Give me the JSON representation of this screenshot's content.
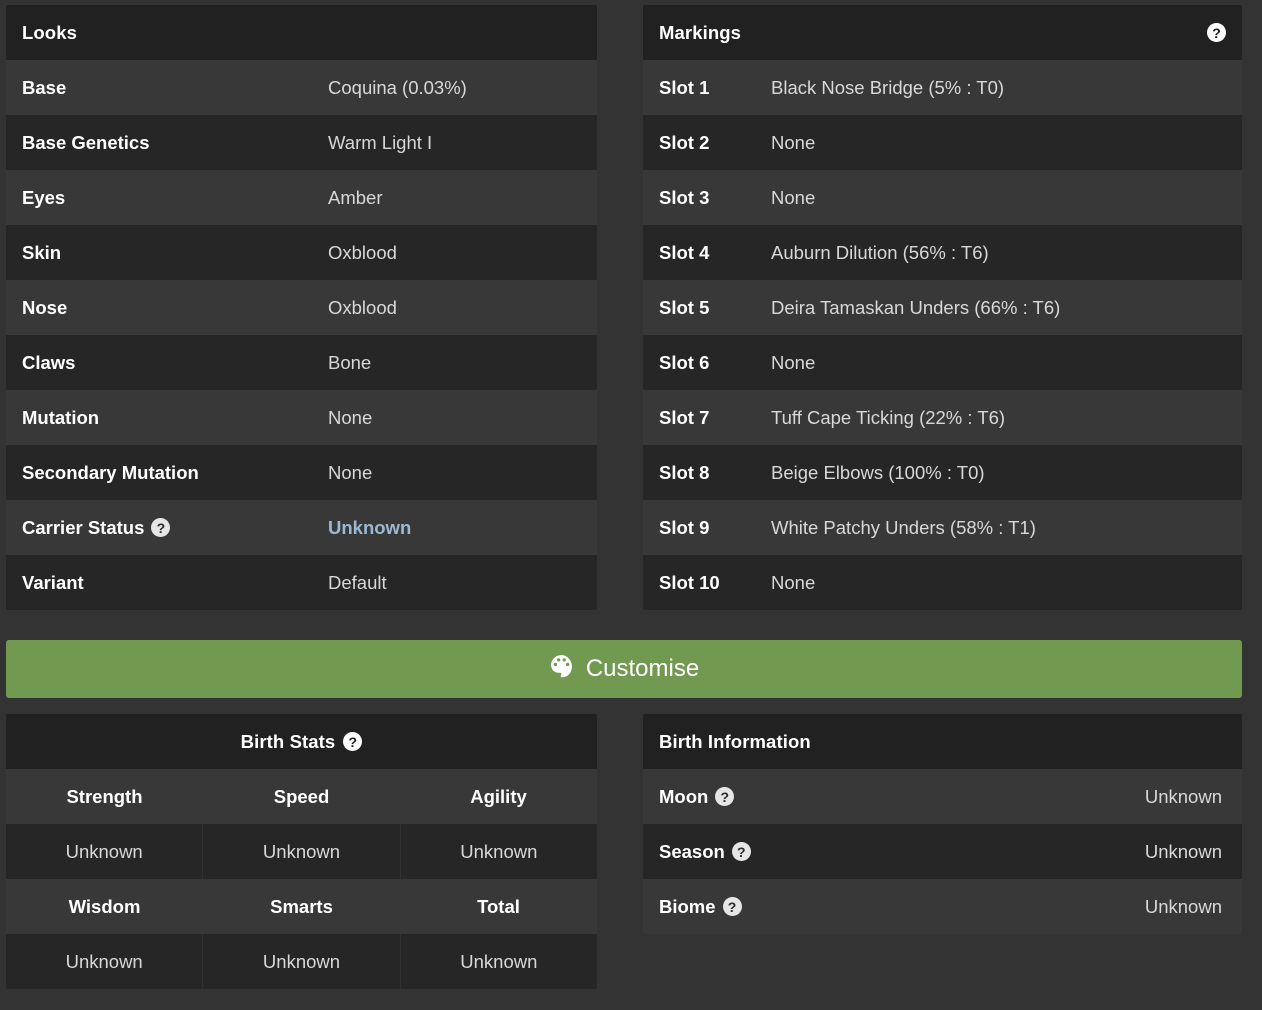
{
  "colors": {
    "page_background": "#333333",
    "panel_background": "#2b2b2b",
    "panel_header": "#212121",
    "row_odd": "#383838",
    "row_even": "#262626",
    "accent_green": "#729950",
    "link_blue": "#9cb9d4",
    "text_primary": "#ffffff",
    "text_value": "#d8d8d8"
  },
  "looks": {
    "title": "Looks",
    "rows": [
      {
        "key": "Base",
        "value": "Coquina (0.03%)",
        "help": false,
        "link": false
      },
      {
        "key": "Base Genetics",
        "value": "Warm Light I",
        "help": false,
        "link": false
      },
      {
        "key": "Eyes",
        "value": "Amber",
        "help": false,
        "link": false
      },
      {
        "key": "Skin",
        "value": "Oxblood",
        "help": false,
        "link": false
      },
      {
        "key": "Nose",
        "value": "Oxblood",
        "help": false,
        "link": false
      },
      {
        "key": "Claws",
        "value": "Bone",
        "help": false,
        "link": false
      },
      {
        "key": "Mutation",
        "value": "None",
        "help": false,
        "link": false
      },
      {
        "key": "Secondary Mutation",
        "value": "None",
        "help": false,
        "link": false
      },
      {
        "key": "Carrier Status",
        "value": "Unknown",
        "help": true,
        "link": true
      },
      {
        "key": "Variant",
        "value": "Default",
        "help": false,
        "link": false
      }
    ]
  },
  "markings": {
    "title": "Markings",
    "header_help_icon": "help-circle-icon",
    "rows": [
      {
        "key": "Slot 1",
        "value": "Black Nose Bridge (5% : T0)"
      },
      {
        "key": "Slot 2",
        "value": "None"
      },
      {
        "key": "Slot 3",
        "value": "None"
      },
      {
        "key": "Slot 4",
        "value": "Auburn Dilution (56% : T6)"
      },
      {
        "key": "Slot 5",
        "value": "Deira Tamaskan Unders (66% : T6)"
      },
      {
        "key": "Slot 6",
        "value": "None"
      },
      {
        "key": "Slot 7",
        "value": "Tuff Cape Ticking (22% : T6)"
      },
      {
        "key": "Slot 8",
        "value": "Beige Elbows (100% : T0)"
      },
      {
        "key": "Slot 9",
        "value": "White Patchy Unders (58% : T1)"
      },
      {
        "key": "Slot 10",
        "value": "None"
      }
    ]
  },
  "customise": {
    "label": "Customise",
    "icon": "palette-icon"
  },
  "birth_stats": {
    "title": "Birth Stats",
    "header_help_icon": "help-circle-icon",
    "rows": [
      {
        "type": "head",
        "cells": [
          "Strength",
          "Speed",
          "Agility"
        ]
      },
      {
        "type": "vals",
        "cells": [
          "Unknown",
          "Unknown",
          "Unknown"
        ]
      },
      {
        "type": "head",
        "cells": [
          "Wisdom",
          "Smarts",
          "Total"
        ]
      },
      {
        "type": "vals",
        "cells": [
          "Unknown",
          "Unknown",
          "Unknown"
        ]
      }
    ]
  },
  "birth_information": {
    "title": "Birth Information",
    "rows": [
      {
        "key": "Moon",
        "value": "Unknown",
        "help": true
      },
      {
        "key": "Season",
        "value": "Unknown",
        "help": true
      },
      {
        "key": "Biome",
        "value": "Unknown",
        "help": true
      }
    ]
  }
}
